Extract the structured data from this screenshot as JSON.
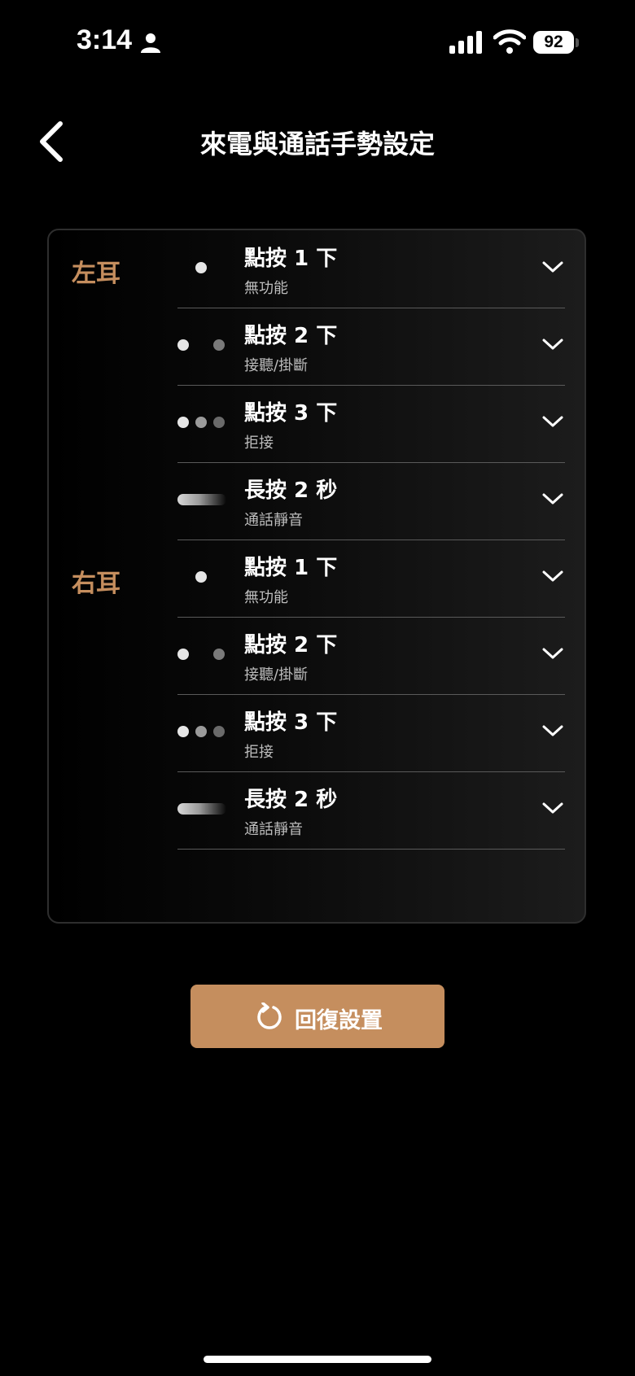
{
  "status_bar": {
    "time": "3:14",
    "battery": "92"
  },
  "header": {
    "title": "來電與通話手勢設定"
  },
  "ears": [
    {
      "label": "左耳",
      "gestures": [
        {
          "title": "點按 1 下",
          "action": "無功能",
          "icon": "single-tap-icon"
        },
        {
          "title": "點按 2 下",
          "action": "接聽/掛斷",
          "icon": "double-tap-icon"
        },
        {
          "title": "點按 3 下",
          "action": "拒接",
          "icon": "triple-tap-icon"
        },
        {
          "title": "長按 2 秒",
          "action": "通話靜音",
          "icon": "long-press-icon"
        }
      ]
    },
    {
      "label": "右耳",
      "gestures": [
        {
          "title": "點按 1 下",
          "action": "無功能",
          "icon": "single-tap-icon"
        },
        {
          "title": "點按 2 下",
          "action": "接聽/掛斷",
          "icon": "double-tap-icon"
        },
        {
          "title": "點按 3 下",
          "action": "拒接",
          "icon": "triple-tap-icon"
        },
        {
          "title": "長按 2 秒",
          "action": "通話靜音",
          "icon": "long-press-icon"
        }
      ]
    }
  ],
  "reset_button": {
    "label": "回復設置"
  },
  "colors": {
    "accent": "#c58e5e",
    "background": "#000000",
    "divider": "#5a5a5a"
  }
}
